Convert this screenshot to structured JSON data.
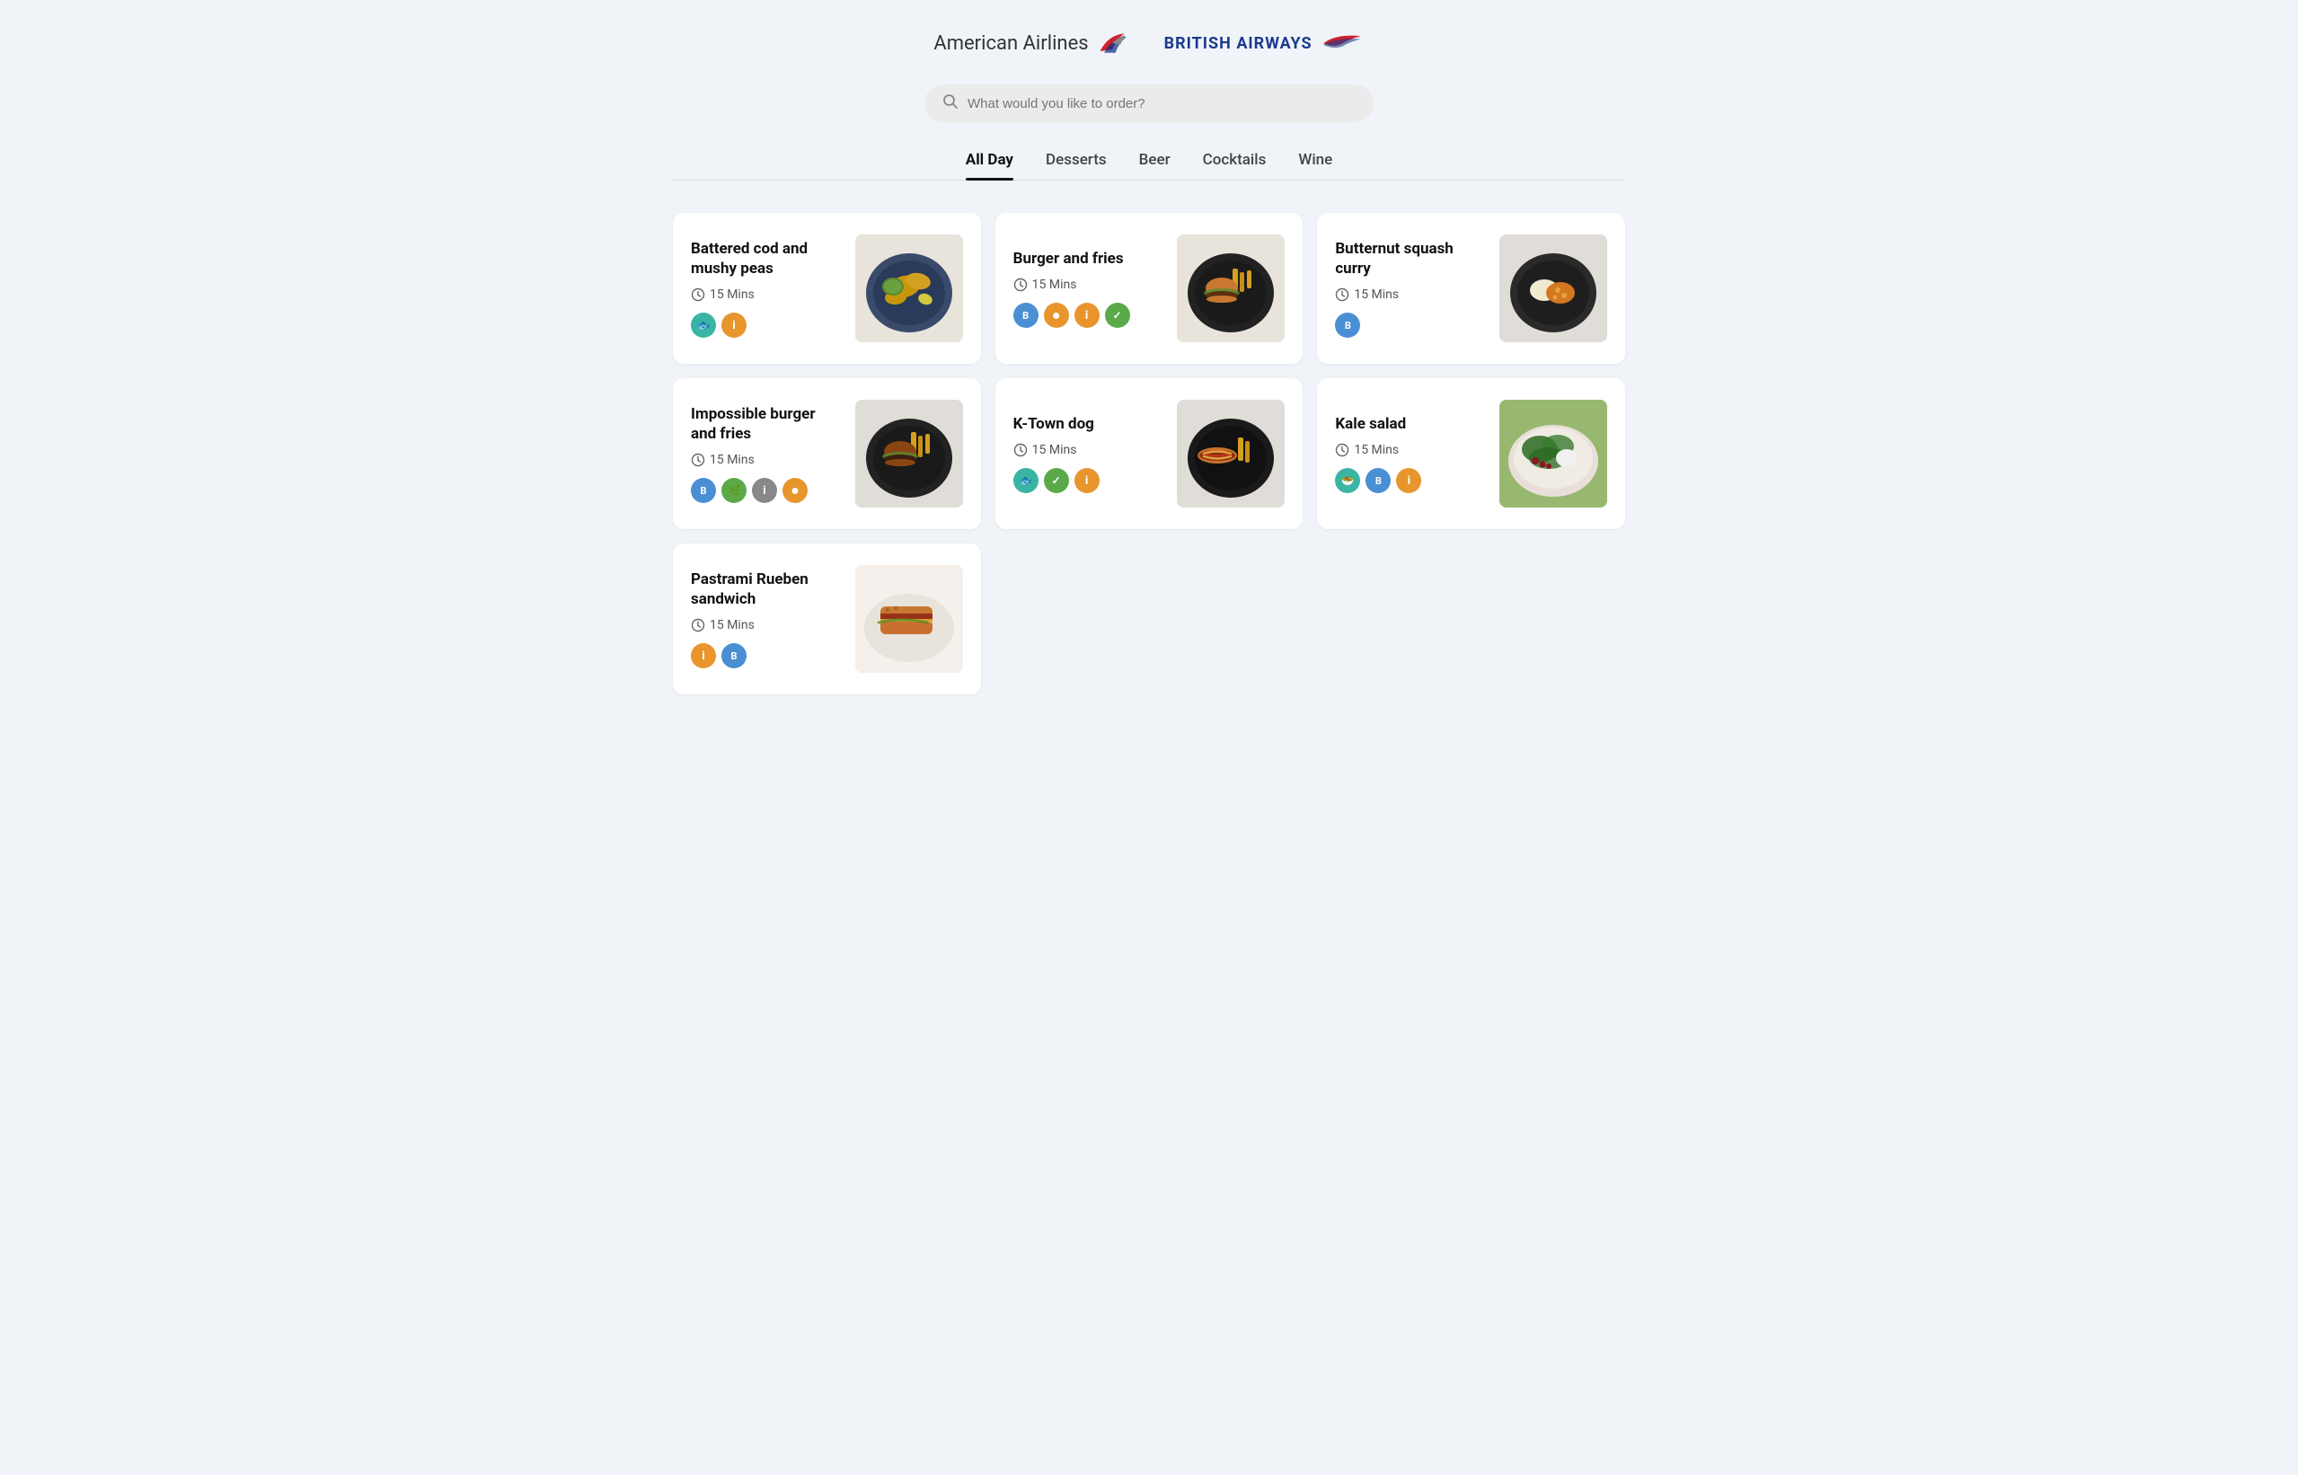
{
  "header": {
    "aa_label": "American Airlines",
    "ba_label": "BRITISH AIRWAYS"
  },
  "search": {
    "placeholder": "What would you like to order?"
  },
  "tabs": [
    {
      "id": "all-day",
      "label": "All Day",
      "active": true
    },
    {
      "id": "desserts",
      "label": "Desserts",
      "active": false
    },
    {
      "id": "beer",
      "label": "Beer",
      "active": false
    },
    {
      "id": "cocktails",
      "label": "Cocktails",
      "active": false
    },
    {
      "id": "wine",
      "label": "Wine",
      "active": false
    }
  ],
  "menu_items": [
    {
      "id": "battered-cod",
      "title": "Battered cod and mushy peas",
      "time": "15 Mins",
      "badges": [
        {
          "color": "teal",
          "symbol": "🐟"
        },
        {
          "color": "orange",
          "symbol": "i"
        }
      ],
      "image_desc": "battered cod with mushy peas on dark plate"
    },
    {
      "id": "burger-fries",
      "title": "Burger and fries",
      "time": "15 Mins",
      "badges": [
        {
          "color": "blue",
          "symbol": "B"
        },
        {
          "color": "orange",
          "symbol": "●"
        },
        {
          "color": "orange",
          "symbol": "i"
        },
        {
          "color": "green",
          "symbol": "✓"
        }
      ],
      "image_desc": "burger and fries on dark plate"
    },
    {
      "id": "butternut-squash",
      "title": "Butternut squash curry",
      "time": "15 Mins",
      "badges": [
        {
          "color": "blue",
          "symbol": "B"
        }
      ],
      "image_desc": "butternut squash curry on dark plate"
    },
    {
      "id": "impossible-burger",
      "title": "Impossible burger and fries",
      "time": "15 Mins",
      "badges": [
        {
          "color": "blue",
          "symbol": "B"
        },
        {
          "color": "green",
          "symbol": "🌿"
        },
        {
          "color": "gray",
          "symbol": "i"
        },
        {
          "color": "orange",
          "symbol": "●"
        }
      ],
      "image_desc": "impossible burger and fries on dark plate"
    },
    {
      "id": "ktown-dog",
      "title": "K-Town dog",
      "time": "15 Mins",
      "badges": [
        {
          "color": "teal",
          "symbol": "🐟"
        },
        {
          "color": "green",
          "symbol": "✓"
        },
        {
          "color": "orange",
          "symbol": "i"
        }
      ],
      "image_desc": "K-town dog with fries on dark plate"
    },
    {
      "id": "kale-salad",
      "title": "Kale salad",
      "time": "15 Mins",
      "badges": [
        {
          "color": "teal",
          "symbol": "🥗"
        },
        {
          "color": "blue",
          "symbol": "B"
        },
        {
          "color": "orange",
          "symbol": "i"
        }
      ],
      "image_desc": "kale salad in white bowl"
    },
    {
      "id": "pastrami",
      "title": "Pastrami Rueben sandwich",
      "time": "15 Mins",
      "badges": [
        {
          "color": "orange",
          "symbol": "i"
        },
        {
          "color": "blue",
          "symbol": "B"
        }
      ],
      "image_desc": "pastrami reuben sandwich on white plate"
    }
  ],
  "badge_colors": {
    "teal": "#3ab5a4",
    "orange": "#e8952e",
    "green": "#5aaa4a",
    "blue": "#4a8fd4",
    "gray": "#888888"
  }
}
